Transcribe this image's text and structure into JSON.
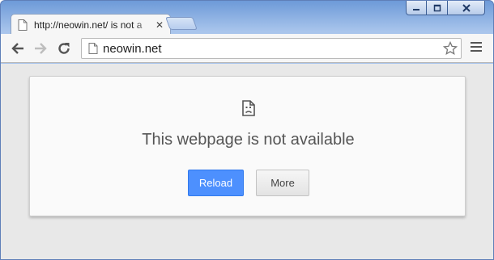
{
  "tab": {
    "title": "http://neowin.net/ is not a",
    "close_glyph": "✕"
  },
  "toolbar": {
    "url": "neowin.net"
  },
  "error": {
    "title": "This webpage is not available"
  },
  "buttons": {
    "reload": "Reload",
    "more": "More"
  },
  "colors": {
    "accent": "#4d90fe",
    "frame": "#6d9ad8"
  }
}
